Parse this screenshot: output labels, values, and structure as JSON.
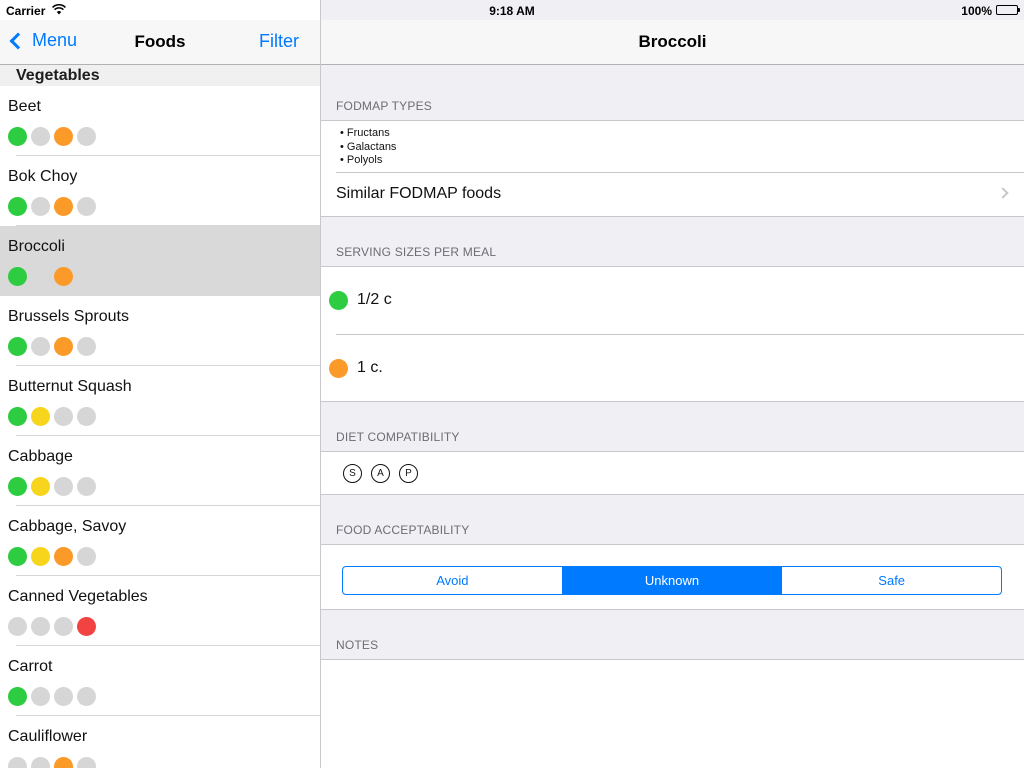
{
  "status_bar": {
    "carrier": "Carrier",
    "time": "9:18 AM",
    "battery": "100%"
  },
  "left_nav": {
    "back_label": "Menu",
    "title": "Foods",
    "filter_label": "Filter"
  },
  "section": "Vegetables",
  "colors": {
    "green": "#2ecc40",
    "gray": "#d6d6d6",
    "orange": "#fb9a28",
    "yellow": "#f7d51d",
    "red": "#f24343",
    "accent": "#007aff"
  },
  "foods": [
    {
      "name": "Beet",
      "dots": [
        "green",
        "gray",
        "orange",
        "gray"
      ],
      "selected": false
    },
    {
      "name": "Bok Choy",
      "dots": [
        "green",
        "gray",
        "orange",
        "gray"
      ],
      "selected": false
    },
    {
      "name": "Broccoli",
      "dots": [
        "green",
        "none",
        "orange"
      ],
      "selected": true
    },
    {
      "name": "Brussels Sprouts",
      "dots": [
        "green",
        "gray",
        "orange",
        "gray"
      ],
      "selected": false
    },
    {
      "name": "Butternut Squash",
      "dots": [
        "green",
        "yellow",
        "gray",
        "gray"
      ],
      "selected": false
    },
    {
      "name": "Cabbage",
      "dots": [
        "green",
        "yellow",
        "gray",
        "gray"
      ],
      "selected": false
    },
    {
      "name": "Cabbage, Savoy",
      "dots": [
        "green",
        "yellow",
        "orange",
        "gray"
      ],
      "selected": false
    },
    {
      "name": "Canned Vegetables",
      "dots": [
        "gray",
        "gray",
        "gray",
        "red"
      ],
      "selected": false
    },
    {
      "name": "Carrot",
      "dots": [
        "green",
        "gray",
        "gray",
        "gray"
      ],
      "selected": false
    },
    {
      "name": "Cauliflower",
      "dots": [
        "gray",
        "gray",
        "orange",
        "gray"
      ],
      "selected": false
    }
  ],
  "detail": {
    "title": "Broccoli",
    "fodmap_types_label": "FODMAP TYPES",
    "fodmap_types": [
      "• Fructans",
      "• Galactans",
      "• Polyols"
    ],
    "similar_label": "Similar FODMAP foods",
    "serving_label": "SERVING SIZES PER MEAL",
    "servings": [
      {
        "color": "green",
        "text": "1/2 c"
      },
      {
        "color": "orange",
        "text": "1 c."
      }
    ],
    "diet_label": "DIET COMPATIBILITY",
    "diet_badges": [
      "S",
      "A",
      "P"
    ],
    "acceptability_label": "FOOD ACCEPTABILITY",
    "acceptability_options": [
      "Avoid",
      "Unknown",
      "Safe"
    ],
    "acceptability_selected": "Unknown",
    "notes_label": "NOTES"
  }
}
